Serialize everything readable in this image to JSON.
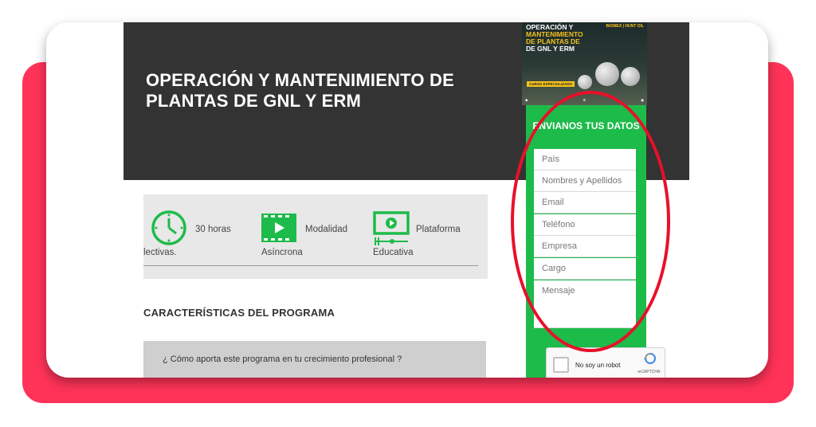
{
  "hero": {
    "title": "OPERACIÓN Y MANTENIMIENTO DE PLANTAS DE GNL Y ERM"
  },
  "banner": {
    "title_line1": "OPERACIÓN Y",
    "title_line2": "MANTENIMIENTO",
    "title_line3": "DE PLANTAS DE",
    "title_line4": "DE GNL Y ERM",
    "brand": "BIOMEX | HUNT OIL",
    "course": "CURSO ESPECIALIZADO"
  },
  "features": [
    {
      "icon": "clock-icon",
      "label": "30 horas",
      "sub": "lectivas."
    },
    {
      "icon": "play-video-icon",
      "label": "Modalidad",
      "sub": "Asíncrona"
    },
    {
      "icon": "video-platform-icon",
      "label": "Plataforma",
      "sub": "Educativa"
    }
  ],
  "section_title": "CARACTERÍSTICAS DEL PROGRAMA",
  "faq": {
    "question": "¿ Cómo aporta este programa en tu crecimiento profesional ?"
  },
  "form": {
    "title": "ENVIANOS TUS DATOS",
    "fields": [
      "País",
      "Nombres y Apellidos",
      "Email",
      "Teléfono",
      "Empresa",
      "Cargo",
      "Mensaje"
    ],
    "captcha_label": "No soy un robot",
    "captcha_brand": "reCAPTCHA"
  },
  "colors": {
    "accent_red": "#ff3358",
    "form_green": "#1dbb4a",
    "hero_dark": "#333333",
    "annotation_red": "#e8102a"
  }
}
